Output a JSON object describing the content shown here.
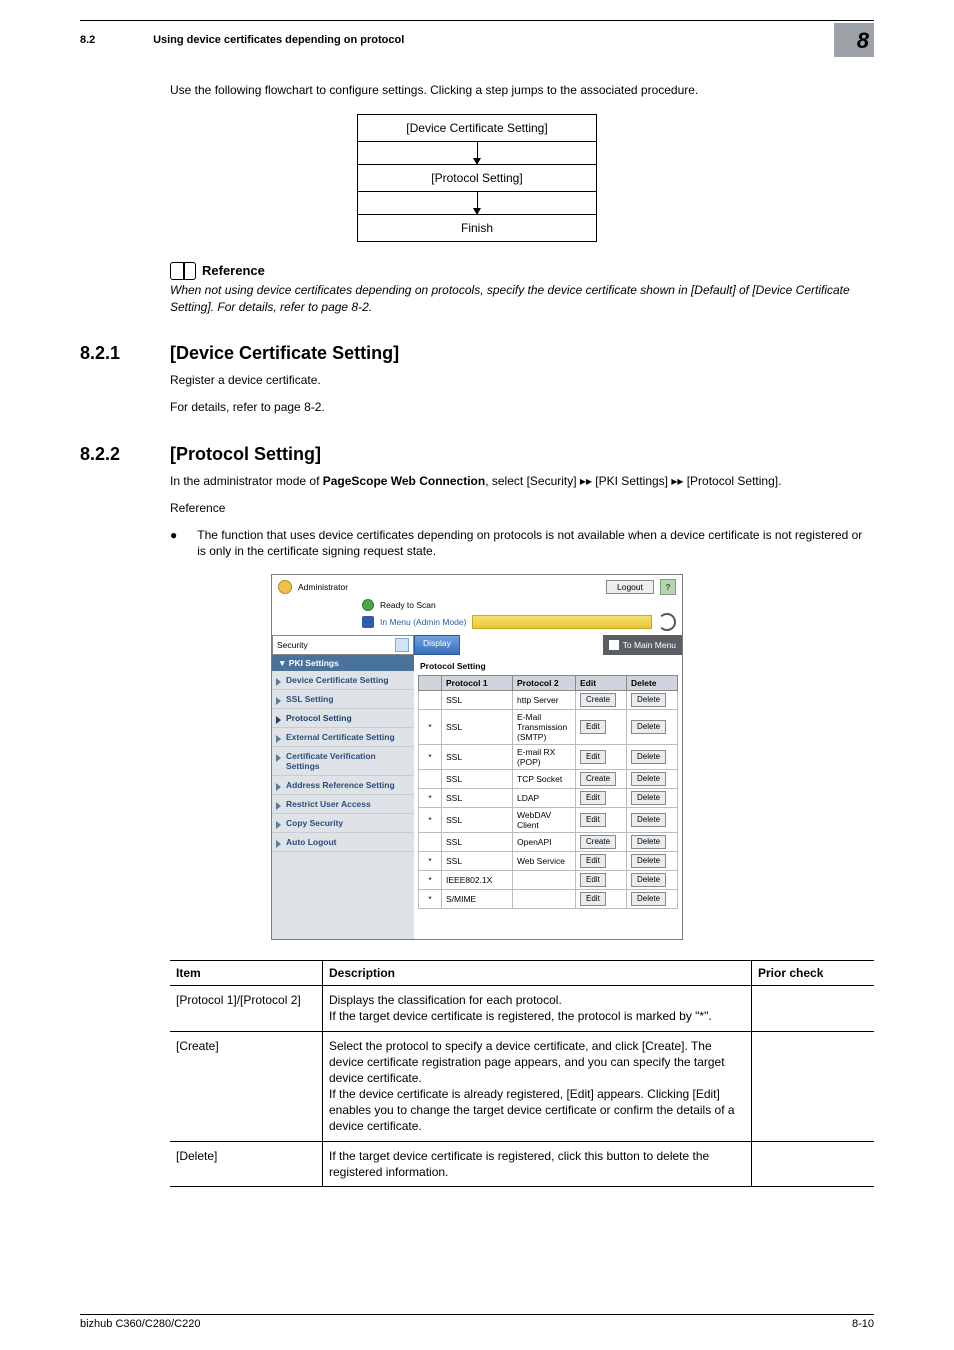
{
  "header": {
    "section_no": "8.2",
    "section_title": "Using device certificates depending on protocol",
    "chapter": "8"
  },
  "intro": "Use the following flowchart to configure settings. Clicking a step jumps to the associated procedure.",
  "flow": {
    "step1": "[Device Certificate Setting]",
    "step2": "[Protocol Setting]",
    "step3": "Finish"
  },
  "reference": {
    "label": "Reference",
    "text": "When not using device certificates depending on protocols, specify the device certificate shown in [Default] of [Device Certificate Setting]. For details, refer to page 8-2."
  },
  "s821": {
    "num": "8.2.1",
    "title": "[Device Certificate Setting]",
    "p1": "Register a device certificate.",
    "p2": "For details, refer to page 8-2."
  },
  "s822": {
    "num": "8.2.2",
    "title": "[Protocol Setting]",
    "p1a": "In the administrator mode of ",
    "p1b": "PageScope Web Connection",
    "p1c": ", select [Security] ▸▸ [PKI Settings] ▸▸ [Protocol Setting].",
    "p2": "Reference",
    "bullet": "The function that uses device certificates depending on protocols is not available when a device certificate is not registered or is only in the certificate signing request state."
  },
  "shot": {
    "admin": "Administrator",
    "logout": "Logout",
    "help": "?",
    "ready": "Ready to Scan",
    "mode": "In Menu (Admin Mode)",
    "security": "Security",
    "display": "Display",
    "to_main": "To Main Menu",
    "side_head": "PKI Settings",
    "side": [
      "Device Certificate Setting",
      "SSL Setting",
      "Protocol Setting",
      "External Certificate Setting",
      "Certificate Verification Settings",
      "Address Reference Setting",
      "Restrict User Access",
      "Copy Security",
      "Auto Logout"
    ],
    "content_title": "Protocol Setting",
    "cols": {
      "p1": "Protocol 1",
      "p2": "Protocol 2",
      "edit": "Edit",
      "del": "Delete"
    },
    "btn_edit": "Edit",
    "btn_create": "Create",
    "btn_delete": "Delete",
    "rows": [
      {
        "star": "",
        "p1": "SSL",
        "p2": "http Server",
        "edit": "Create"
      },
      {
        "star": "*",
        "p1": "SSL",
        "p2": "E-Mail Transmission (SMTP)",
        "edit": "Edit"
      },
      {
        "star": "*",
        "p1": "SSL",
        "p2": "E-mail RX (POP)",
        "edit": "Edit"
      },
      {
        "star": "",
        "p1": "SSL",
        "p2": "TCP Socket",
        "edit": "Create"
      },
      {
        "star": "*",
        "p1": "SSL",
        "p2": "LDAP",
        "edit": "Edit"
      },
      {
        "star": "*",
        "p1": "SSL",
        "p2": "WebDAV Client",
        "edit": "Edit"
      },
      {
        "star": "",
        "p1": "SSL",
        "p2": "OpenAPI",
        "edit": "Create"
      },
      {
        "star": "*",
        "p1": "SSL",
        "p2": "Web Service",
        "edit": "Edit"
      },
      {
        "star": "*",
        "p1": "IEEE802.1X",
        "p2": "",
        "edit": "Edit"
      },
      {
        "star": "*",
        "p1": "S/MIME",
        "p2": "",
        "edit": "Edit"
      }
    ]
  },
  "items_table": {
    "h1": "Item",
    "h2": "Description",
    "h3": "Prior check",
    "rows": [
      {
        "item": "[Protocol 1]/[Proto­col 2]",
        "desc": "Displays the classification for each protocol.\nIf the target device certificate is registered, the protocol is marked by \"*\"."
      },
      {
        "item": "[Create]",
        "desc": "Select the protocol to specify a device certificate, and click [Create]. The device certificate registration page ap­pears, and you can specify the target device certificate.\nIf the device certificate is already registered, [Edit] ap­pears. Clicking [Edit] enables you to change the target de­vice certificate or confirm the details of a device certificate."
      },
      {
        "item": "[Delete]",
        "desc": "If the target device certificate is registered, click this but­ton to delete the registered information."
      }
    ]
  },
  "footer": {
    "left": "bizhub C360/C280/C220",
    "right": "8-10"
  }
}
